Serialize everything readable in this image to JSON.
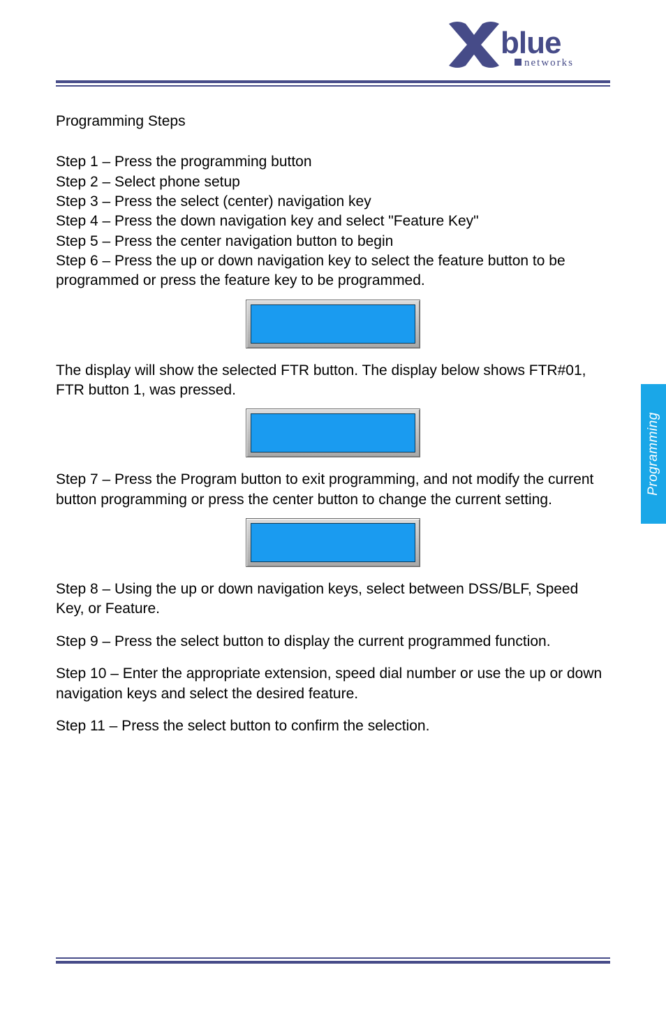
{
  "brand": {
    "name": "blue",
    "sub": "networks"
  },
  "side_tab": "Programming",
  "title": "Programming Steps",
  "steps_a": [
    "Step 1 – Press the programming button",
    "Step 2 – Select phone setup",
    "Step 3 – Press the select (center) navigation key",
    "Step 4 – Press the down navigation key and select \"Feature Key\"",
    "Step 5 – Press the center navigation button to begin",
    "Step 6 – Press the up or down navigation key to select the feature button to be programmed or press the feature key to be programmed."
  ],
  "para_1": "The display will show the selected FTR button.  The display below shows FTR#01, FTR button 1, was pressed.",
  "step_7": "Step 7 – Press the Program button to exit programming, and not modify the current button programming or press the center button to change the current setting.",
  "step_8": "Step 8 – Using the up or down navigation keys, select between DSS/BLF, Speed Key, or Feature.",
  "step_9": "Step 9 – Press the select button to display the current programmed function.",
  "step_10": "Step 10 – Enter the appropriate extension, speed dial number or use the up or down navigation keys and select the desired feature.",
  "step_11": "Step 11 – Press the select button to confirm the selection."
}
